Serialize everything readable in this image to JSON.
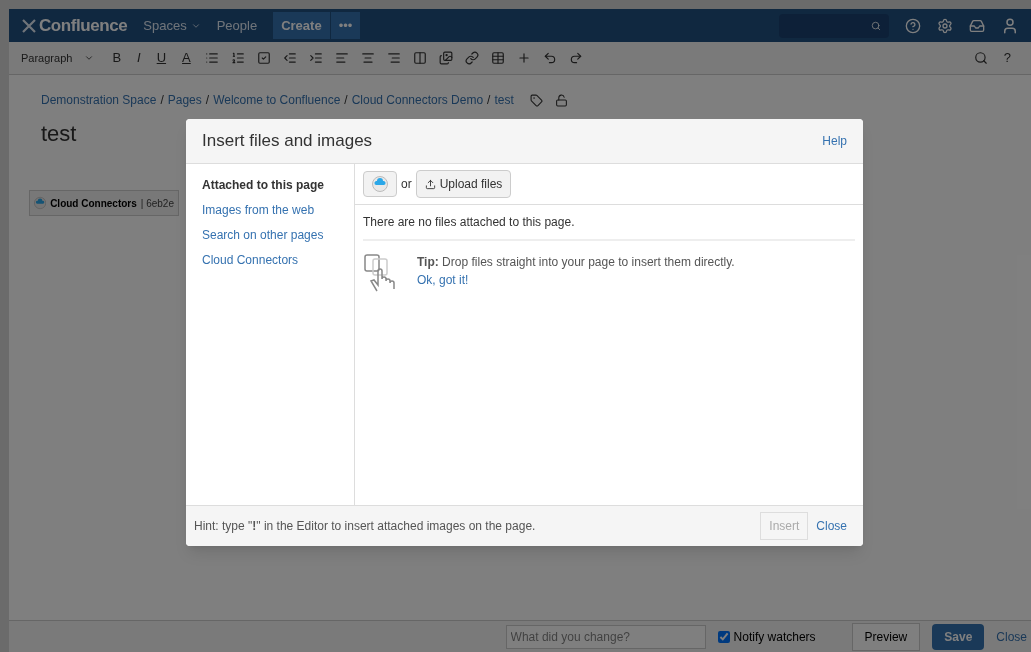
{
  "header": {
    "logo": "Confluence",
    "nav": [
      {
        "label": "Spaces",
        "dropdown": true
      },
      {
        "label": "People",
        "dropdown": false
      }
    ],
    "create": "Create",
    "more": "•••"
  },
  "toolbar": {
    "paragraph": "Paragraph",
    "format": [
      "B",
      "I",
      "U",
      "A"
    ],
    "help": "?"
  },
  "breadcrumb_separator": "/",
  "breadcrumbs": [
    "Demonstration Space",
    "Pages",
    "Welcome to Confluence",
    "Cloud Connectors Demo",
    "test"
  ],
  "page_title": "test",
  "macro": {
    "name": "Cloud Connectors",
    "detail": "| 6eb2e"
  },
  "dialog": {
    "title": "Insert files and images",
    "help": "Help",
    "nav": [
      {
        "label": "Attached to this page",
        "selected": true
      },
      {
        "label": "Images from the web",
        "selected": false
      },
      {
        "label": "Search on other pages",
        "selected": false
      },
      {
        "label": "Cloud Connectors",
        "selected": false
      }
    ],
    "or": "or",
    "upload": "Upload files",
    "empty": "There are no files attached to this page.",
    "tip": "**Tip:** Drop files straight into your page to insert them directly.",
    "tip_link": "Ok, got it!",
    "hint": "Hint: type \"**!**\" in the Editor to insert attached images on the page.",
    "insert": {
      "label": "Insert",
      "disabled": true
    },
    "close": "Close"
  },
  "footer": {
    "placeholder": "What did you change?",
    "notify": {
      "label": "Notify watchers",
      "checked": true
    },
    "preview": "Preview",
    "save": "Save",
    "close": "Close"
  }
}
